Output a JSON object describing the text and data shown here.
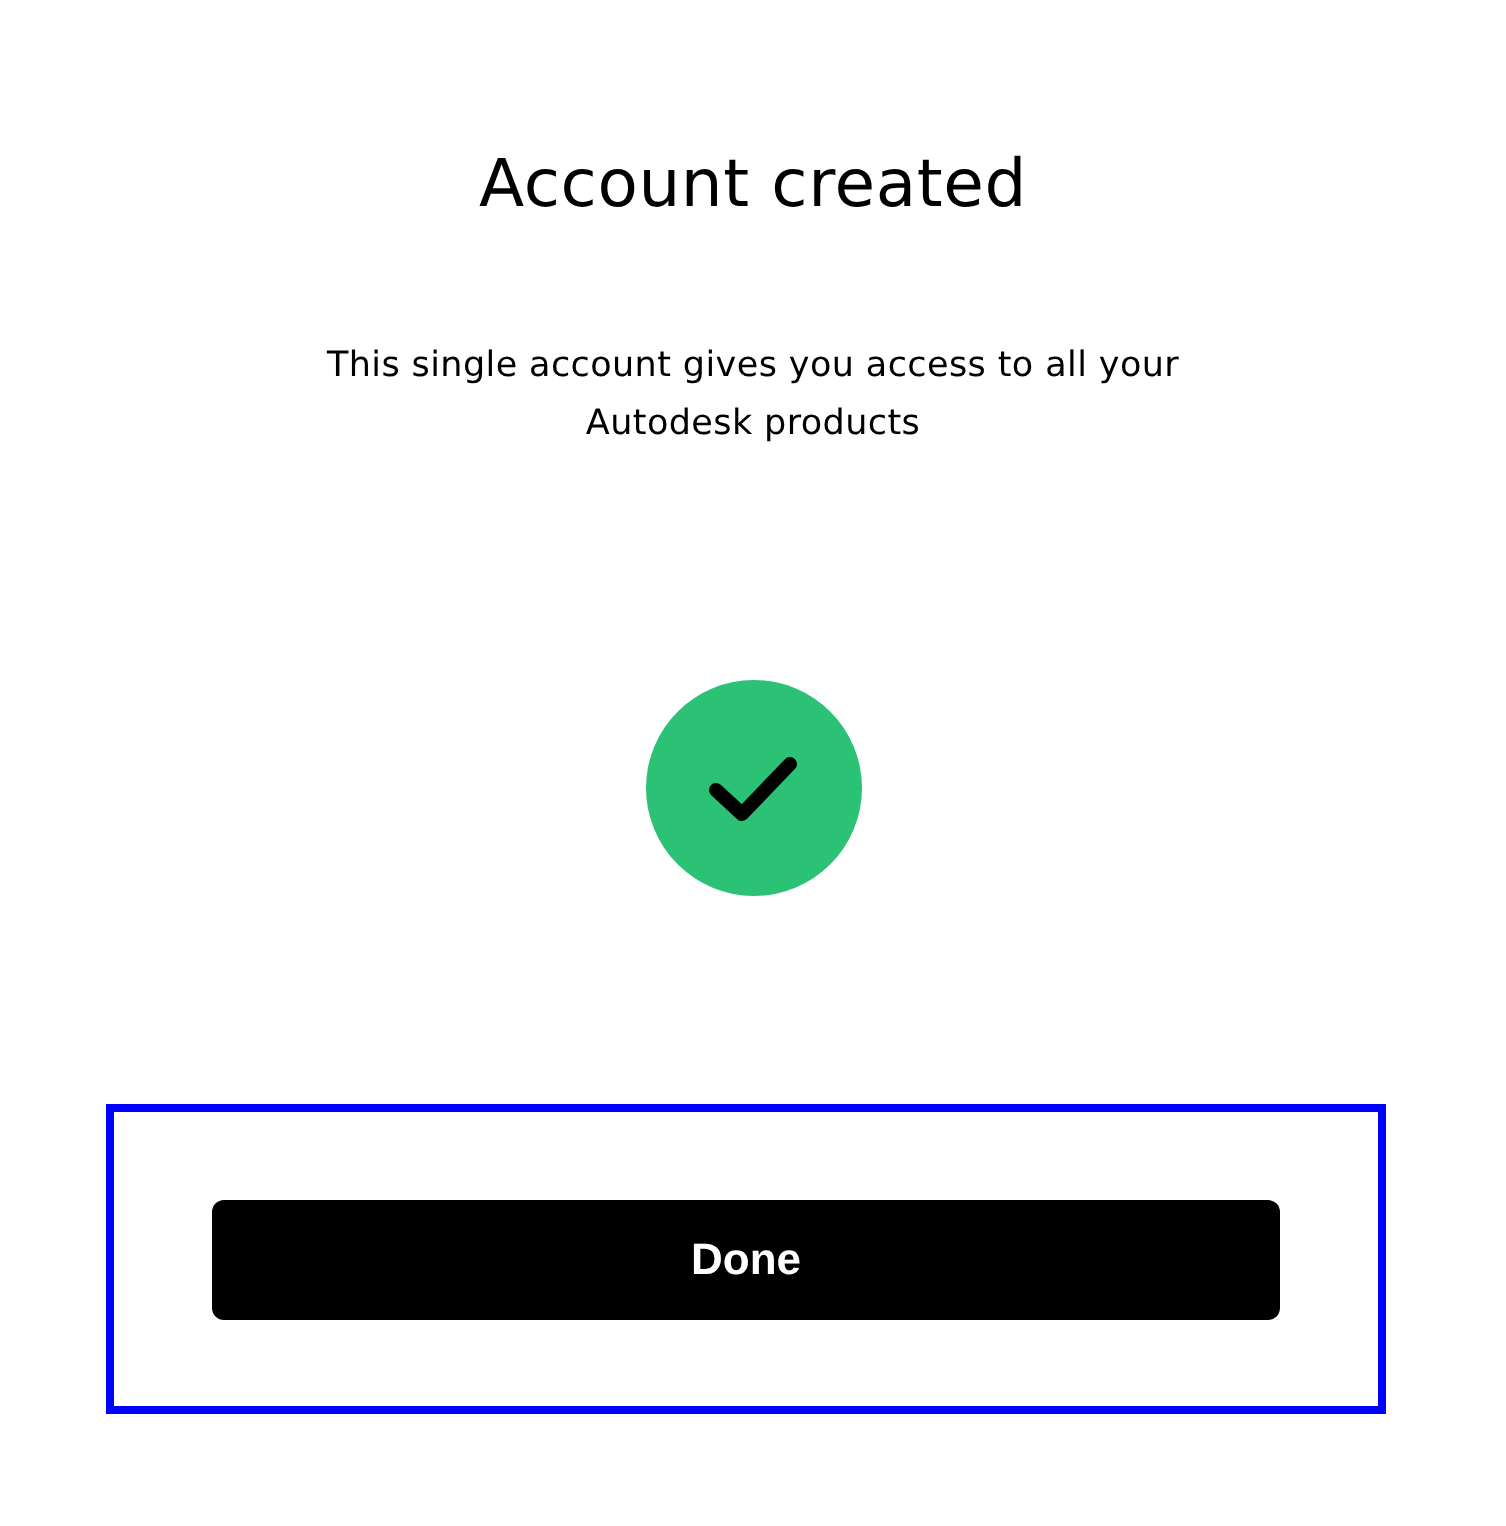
{
  "title": "Account created",
  "message": "This single account gives you access to all your Autodesk products",
  "status": {
    "kind": "success"
  },
  "button": {
    "label": "Done"
  }
}
